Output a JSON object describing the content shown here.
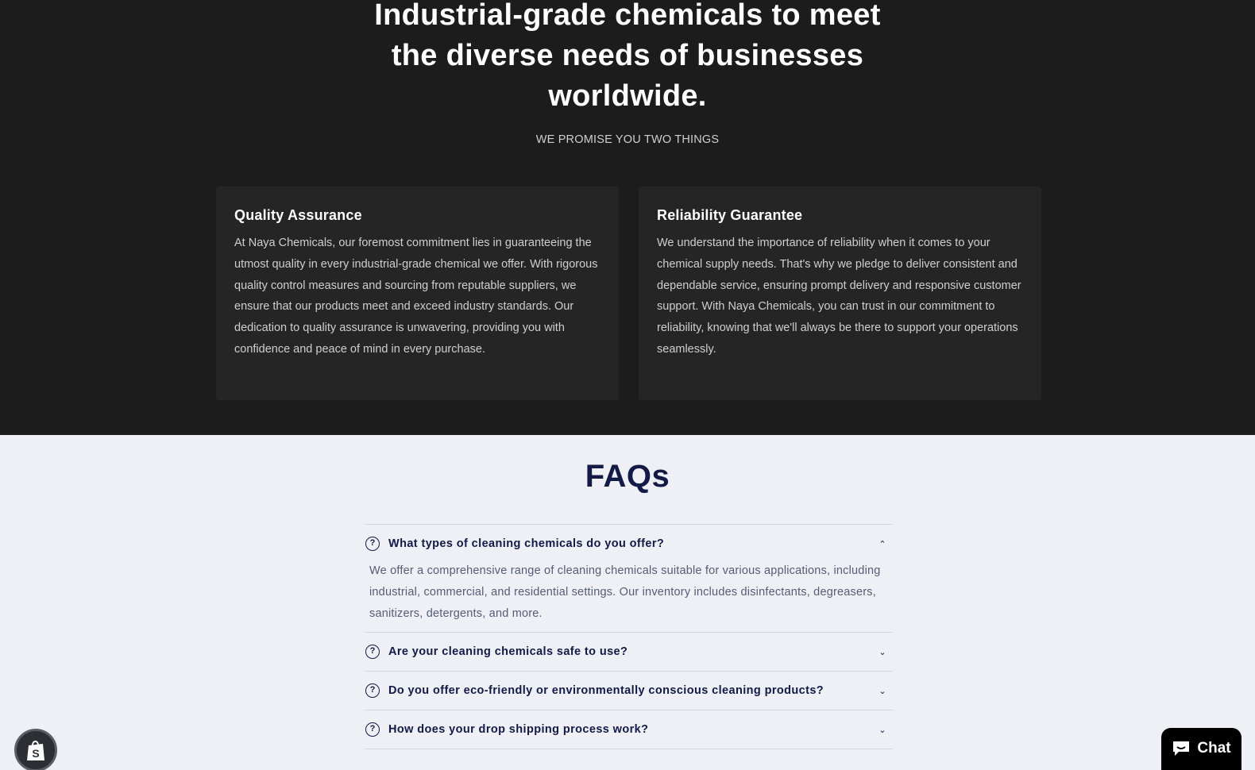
{
  "hero": {
    "title": "Industrial-grade chemicals to meet the diverse needs of businesses worldwide.",
    "subtitle": "WE PROMISE YOU TWO THINGS",
    "cards": [
      {
        "title": "Quality Assurance",
        "body": "At Naya Chemicals, our foremost commitment lies in guaranteeing the utmost quality in every industrial-grade chemical we offer. With rigorous quality control measures and sourcing from reputable suppliers, we ensure that our products meet and exceed industry standards. Our dedication to quality assurance is unwavering, providing you with confidence and peace of mind in every purchase."
      },
      {
        "title": "Reliability Guarantee",
        "body": "We understand the importance of reliability when it comes to your chemical supply needs. That's why we pledge to deliver consistent and dependable service, ensuring prompt delivery and responsive customer support. With Naya Chemicals, you can trust in our commitment to reliability, knowing that we'll always be there to support your operations seamlessly."
      }
    ]
  },
  "faq": {
    "title": "FAQs",
    "items": [
      {
        "question": "What types of cleaning chemicals do you offer?",
        "answer": "We offer a comprehensive range of cleaning chemicals suitable for various applications, including industrial, commercial, and residential settings. Our inventory includes disinfectants, degreasers, sanitizers, detergents, and more.",
        "expanded": true,
        "icon": "chevron-up-icon"
      },
      {
        "question": "Are your cleaning chemicals safe to use?",
        "expanded": false,
        "icon": "chevron-down-icon"
      },
      {
        "question": "Do you offer eco-friendly or environmentally conscious cleaning products?",
        "expanded": false,
        "icon": "chevron-down-icon"
      },
      {
        "question": "How does your drop shipping process work?",
        "expanded": false,
        "icon": "chevron-down-icon"
      }
    ]
  },
  "widgets": {
    "chat_label": "Chat",
    "shop_icon": "shopify-bag-icon",
    "chat_icon": "chat-bubble-icon"
  },
  "colors": {
    "hero_bg": "#1c1c1c",
    "card_bg": "#252525",
    "page_bg": "#eef0f5",
    "heading_navy": "#121a45"
  }
}
